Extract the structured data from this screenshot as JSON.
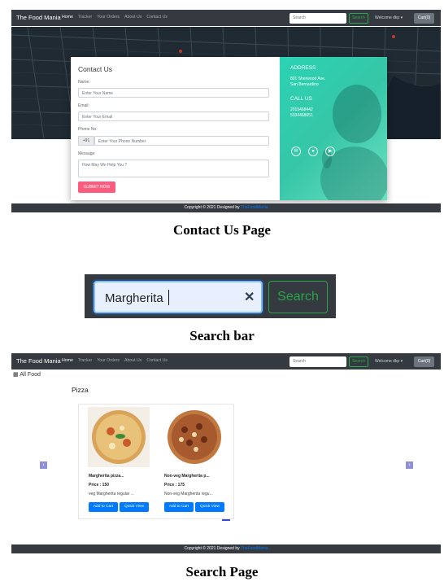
{
  "nav": {
    "brand": "The Food Mania",
    "links": [
      "Home",
      "Tracker",
      "Your Orders",
      "About Us",
      "Contact Us"
    ],
    "search_placeholder": "Search",
    "search_button": "Search",
    "welcome": "Welcome dkp ▾",
    "cart": "Cart(0)"
  },
  "contact": {
    "title": "Contact Us",
    "name_label": "Name:",
    "name_placeholder": "Enter Your Name",
    "email_label": "Email:",
    "email_placeholder": "Enter Your Email",
    "phone_label": "Phone No:",
    "phone_prefix": "+91",
    "phone_placeholder": "Enter Your Phone Number",
    "message_label": "Message:",
    "message_placeholder": "How May We Help You ?",
    "submit": "SUBMIT NOW",
    "address_heading": "ADDRESS",
    "address_line1": "801 Sherwood Ave.",
    "address_line2": "San Bernardino",
    "call_heading": "CALL US",
    "phone1": "2015468442",
    "phone2": "5334468651"
  },
  "footer": {
    "text": "Copyright © 2021 Designed by",
    "link": "TheFoodMania"
  },
  "captions": {
    "contact": "Contact Us Page",
    "searchbar": "Search bar",
    "searchpage": "Search Page"
  },
  "search_bar": {
    "value": "Margherita",
    "clear": "✕",
    "button": "Search"
  },
  "search_page": {
    "all_food": "All Food",
    "category": "Pizza",
    "products": [
      {
        "name": "Margherita pizza...",
        "price": "Price : 150",
        "desc": "veg Margherita regular ...",
        "add": "Add to Cart",
        "view": "Quick View"
      },
      {
        "name": "Non-veg Margherita p...",
        "price": "Price : 175",
        "desc": "Non-veg Margherita regu...",
        "add": "Add to Cart",
        "view": "Quick View"
      }
    ],
    "prev": "‹",
    "next": "›"
  },
  "colors": {
    "navbar": "#343a40",
    "submit": "#fc5c7d",
    "teal_panel": "#2bd3b4",
    "primary": "#007bff",
    "success": "#28a745"
  }
}
